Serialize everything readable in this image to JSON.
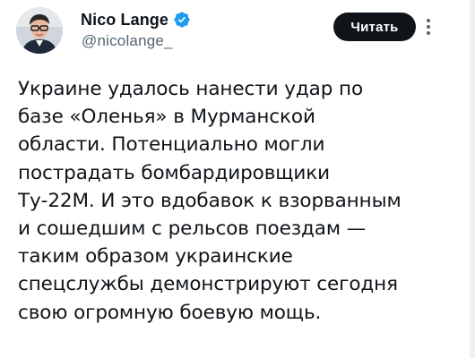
{
  "author": {
    "display_name": "Nico Lange",
    "handle": "@nicolange_",
    "verified": true,
    "verified_color": "#1d9bf0"
  },
  "actions": {
    "follow_label": "Читать"
  },
  "tweet": {
    "lines": [
      "Украине удалось нанести удар по",
      "базе «Оленья» в Мурманской",
      "области. Потенциально могли",
      "пострадать бомбардировщики",
      "Ту-22М. И это вдобавок к взорванным",
      "и сошедшим с рельсов поездам —",
      "таким образом украинские",
      "спецслужбы демонстрируют сегодня",
      "свою огромную боевую мощь."
    ]
  },
  "icons": {
    "verified": "verified-badge-icon",
    "more": "more-options-icon",
    "avatar": "avatar-photo"
  }
}
